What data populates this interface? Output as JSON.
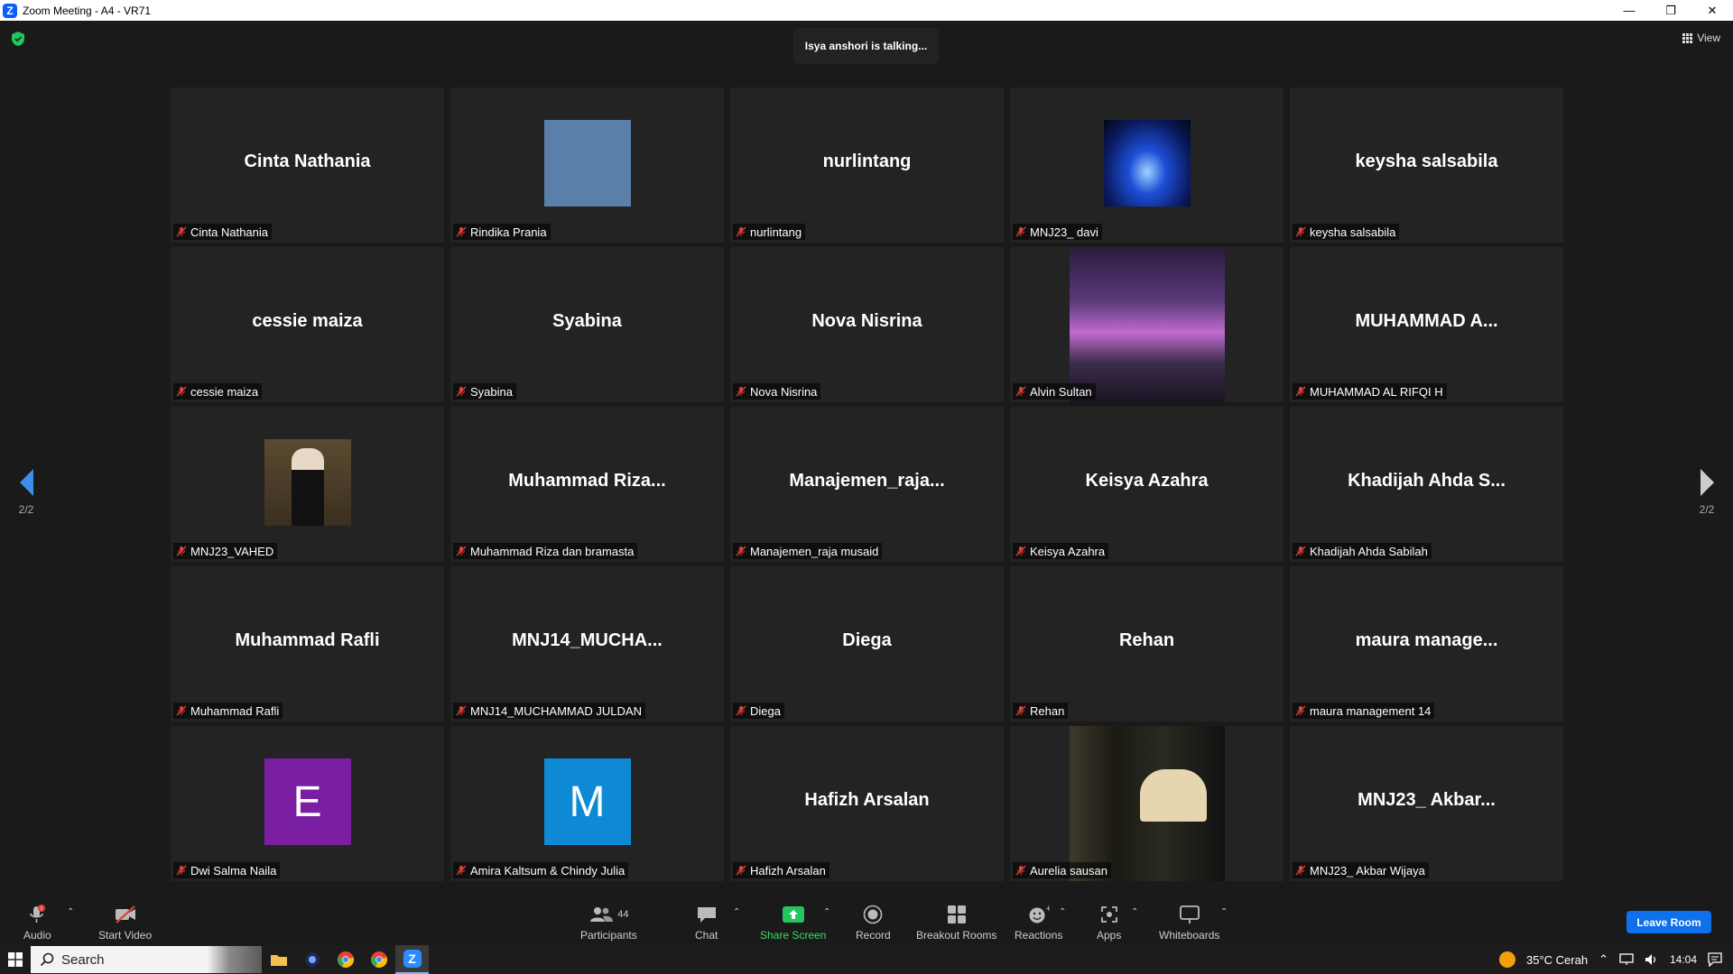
{
  "window": {
    "title": "Zoom Meeting - A4 - VR71"
  },
  "banner": {
    "talking": "Isya anshori is talking..."
  },
  "view_label": "View",
  "pagination": {
    "left": "2/2",
    "right": "2/2"
  },
  "participants": [
    {
      "big": "Cinta Nathania",
      "label": "Cinta Nathania"
    },
    {
      "big": "",
      "label": "Rindika Prania",
      "pic": "blue-square"
    },
    {
      "big": "nurlintang",
      "label": "nurlintang"
    },
    {
      "big": "",
      "label": "MNJ23_ davi",
      "pic": "car-photo"
    },
    {
      "big": "keysha salsabila",
      "label": "keysha salsabila"
    },
    {
      "big": "cessie maiza",
      "label": "cessie maiza"
    },
    {
      "big": "Syabina",
      "label": "Syabina"
    },
    {
      "big": "Nova Nisrina",
      "label": "Nova Nisrina"
    },
    {
      "big": "",
      "label": "Alvin Sultan",
      "pic": "street-photo"
    },
    {
      "big": "MUHAMMAD  A...",
      "label": "MUHAMMAD AL RIFQI H"
    },
    {
      "big": "",
      "label": "MNJ23_VAHED",
      "pic": "person-photo"
    },
    {
      "big": "Muhammad  Riza...",
      "label": "Muhammad Riza dan bramasta"
    },
    {
      "big": "Manajemen_raja...",
      "label": "Manajemen_raja musaid"
    },
    {
      "big": "Keisya Azahra",
      "label": "Keisya Azahra"
    },
    {
      "big": "Khadijah  Ahda  S...",
      "label": "Khadijah Ahda Sabilah"
    },
    {
      "big": "Muhammad Rafli",
      "label": "Muhammad Rafli"
    },
    {
      "big": "MNJ14_MUCHA...",
      "label": "MNJ14_MUCHAMMAD JULDAN"
    },
    {
      "big": "Diega",
      "label": "Diega"
    },
    {
      "big": "Rehan",
      "label": "Rehan"
    },
    {
      "big": "maura  manage...",
      "label": "maura management 14"
    },
    {
      "big": "",
      "label": "Dwi Salma Naila",
      "pic": "letter-avatar",
      "letter": "E",
      "color": "#7b1fa2"
    },
    {
      "big": "",
      "label": "Amira Kaltsum & Chindy Julia",
      "pic": "letter-avatar",
      "letter": "M",
      "color": "#0e8ad4"
    },
    {
      "big": "Hafizh Arsalan",
      "label": "Hafizh Arsalan"
    },
    {
      "big": "",
      "label": "Aurelia sausan",
      "pic": "mailbox-photo"
    },
    {
      "big": "MNJ23_  Akbar...",
      "label": "MNJ23_ Akbar Wijaya"
    }
  ],
  "toolbar": {
    "audio": "Audio",
    "start_video": "Start Video",
    "participants": "Participants",
    "participants_count": "44",
    "chat": "Chat",
    "share_screen": "Share Screen",
    "record": "Record",
    "breakout_rooms": "Breakout Rooms",
    "reactions": "Reactions",
    "apps": "Apps",
    "whiteboards": "Whiteboards",
    "leave_room": "Leave Room"
  },
  "taskbar": {
    "search": "Search",
    "weather": "35°C  Cerah",
    "time": "14:04"
  },
  "colors": {
    "accent": "#0e71eb",
    "share_green": "#22c55e",
    "tile_bg": "#232323",
    "mic_muted": "#e0403a"
  }
}
